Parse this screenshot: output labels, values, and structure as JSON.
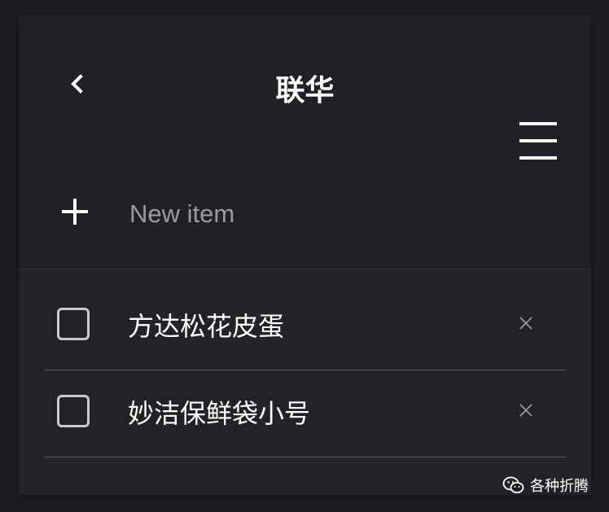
{
  "header": {
    "title": "联华",
    "back_icon": "chevron-left-icon",
    "menu_icon": "hamburger-menu-icon"
  },
  "new_item": {
    "add_icon": "plus-icon",
    "placeholder": "New item",
    "value": ""
  },
  "items": [
    {
      "text": "方达松花皮蛋",
      "checked": false,
      "delete_icon": "close-icon"
    },
    {
      "text": "妙洁保鲜袋小号",
      "checked": false,
      "delete_icon": "close-icon"
    }
  ],
  "watermark": {
    "icon": "wechat-icon",
    "text": "各种折腾"
  },
  "colors": {
    "background": "#1c1d20",
    "card": "#222327",
    "text": "#ffffff",
    "placeholder": "#9a9b9f",
    "divider": "#5a5b5f",
    "delete_icon": "#8e8f93"
  }
}
